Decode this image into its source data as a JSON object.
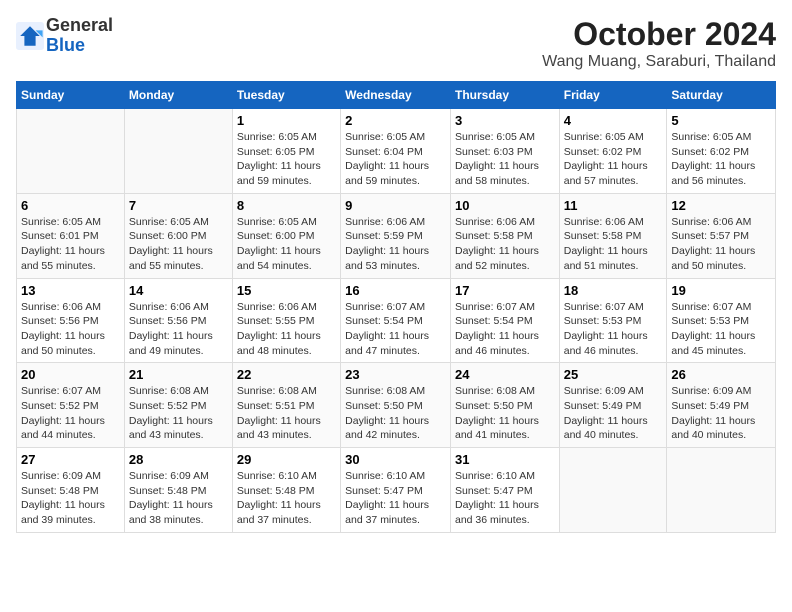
{
  "logo": {
    "general": "General",
    "blue": "Blue"
  },
  "title": "October 2024",
  "location": "Wang Muang, Saraburi, Thailand",
  "days_header": [
    "Sunday",
    "Monday",
    "Tuesday",
    "Wednesday",
    "Thursday",
    "Friday",
    "Saturday"
  ],
  "weeks": [
    [
      {
        "day": "",
        "info": ""
      },
      {
        "day": "",
        "info": ""
      },
      {
        "day": "1",
        "info": "Sunrise: 6:05 AM\nSunset: 6:05 PM\nDaylight: 11 hours and 59 minutes."
      },
      {
        "day": "2",
        "info": "Sunrise: 6:05 AM\nSunset: 6:04 PM\nDaylight: 11 hours and 59 minutes."
      },
      {
        "day": "3",
        "info": "Sunrise: 6:05 AM\nSunset: 6:03 PM\nDaylight: 11 hours and 58 minutes."
      },
      {
        "day": "4",
        "info": "Sunrise: 6:05 AM\nSunset: 6:02 PM\nDaylight: 11 hours and 57 minutes."
      },
      {
        "day": "5",
        "info": "Sunrise: 6:05 AM\nSunset: 6:02 PM\nDaylight: 11 hours and 56 minutes."
      }
    ],
    [
      {
        "day": "6",
        "info": "Sunrise: 6:05 AM\nSunset: 6:01 PM\nDaylight: 11 hours and 55 minutes."
      },
      {
        "day": "7",
        "info": "Sunrise: 6:05 AM\nSunset: 6:00 PM\nDaylight: 11 hours and 55 minutes."
      },
      {
        "day": "8",
        "info": "Sunrise: 6:05 AM\nSunset: 6:00 PM\nDaylight: 11 hours and 54 minutes."
      },
      {
        "day": "9",
        "info": "Sunrise: 6:06 AM\nSunset: 5:59 PM\nDaylight: 11 hours and 53 minutes."
      },
      {
        "day": "10",
        "info": "Sunrise: 6:06 AM\nSunset: 5:58 PM\nDaylight: 11 hours and 52 minutes."
      },
      {
        "day": "11",
        "info": "Sunrise: 6:06 AM\nSunset: 5:58 PM\nDaylight: 11 hours and 51 minutes."
      },
      {
        "day": "12",
        "info": "Sunrise: 6:06 AM\nSunset: 5:57 PM\nDaylight: 11 hours and 50 minutes."
      }
    ],
    [
      {
        "day": "13",
        "info": "Sunrise: 6:06 AM\nSunset: 5:56 PM\nDaylight: 11 hours and 50 minutes."
      },
      {
        "day": "14",
        "info": "Sunrise: 6:06 AM\nSunset: 5:56 PM\nDaylight: 11 hours and 49 minutes."
      },
      {
        "day": "15",
        "info": "Sunrise: 6:06 AM\nSunset: 5:55 PM\nDaylight: 11 hours and 48 minutes."
      },
      {
        "day": "16",
        "info": "Sunrise: 6:07 AM\nSunset: 5:54 PM\nDaylight: 11 hours and 47 minutes."
      },
      {
        "day": "17",
        "info": "Sunrise: 6:07 AM\nSunset: 5:54 PM\nDaylight: 11 hours and 46 minutes."
      },
      {
        "day": "18",
        "info": "Sunrise: 6:07 AM\nSunset: 5:53 PM\nDaylight: 11 hours and 46 minutes."
      },
      {
        "day": "19",
        "info": "Sunrise: 6:07 AM\nSunset: 5:53 PM\nDaylight: 11 hours and 45 minutes."
      }
    ],
    [
      {
        "day": "20",
        "info": "Sunrise: 6:07 AM\nSunset: 5:52 PM\nDaylight: 11 hours and 44 minutes."
      },
      {
        "day": "21",
        "info": "Sunrise: 6:08 AM\nSunset: 5:52 PM\nDaylight: 11 hours and 43 minutes."
      },
      {
        "day": "22",
        "info": "Sunrise: 6:08 AM\nSunset: 5:51 PM\nDaylight: 11 hours and 43 minutes."
      },
      {
        "day": "23",
        "info": "Sunrise: 6:08 AM\nSunset: 5:50 PM\nDaylight: 11 hours and 42 minutes."
      },
      {
        "day": "24",
        "info": "Sunrise: 6:08 AM\nSunset: 5:50 PM\nDaylight: 11 hours and 41 minutes."
      },
      {
        "day": "25",
        "info": "Sunrise: 6:09 AM\nSunset: 5:49 PM\nDaylight: 11 hours and 40 minutes."
      },
      {
        "day": "26",
        "info": "Sunrise: 6:09 AM\nSunset: 5:49 PM\nDaylight: 11 hours and 40 minutes."
      }
    ],
    [
      {
        "day": "27",
        "info": "Sunrise: 6:09 AM\nSunset: 5:48 PM\nDaylight: 11 hours and 39 minutes."
      },
      {
        "day": "28",
        "info": "Sunrise: 6:09 AM\nSunset: 5:48 PM\nDaylight: 11 hours and 38 minutes."
      },
      {
        "day": "29",
        "info": "Sunrise: 6:10 AM\nSunset: 5:48 PM\nDaylight: 11 hours and 37 minutes."
      },
      {
        "day": "30",
        "info": "Sunrise: 6:10 AM\nSunset: 5:47 PM\nDaylight: 11 hours and 37 minutes."
      },
      {
        "day": "31",
        "info": "Sunrise: 6:10 AM\nSunset: 5:47 PM\nDaylight: 11 hours and 36 minutes."
      },
      {
        "day": "",
        "info": ""
      },
      {
        "day": "",
        "info": ""
      }
    ]
  ]
}
